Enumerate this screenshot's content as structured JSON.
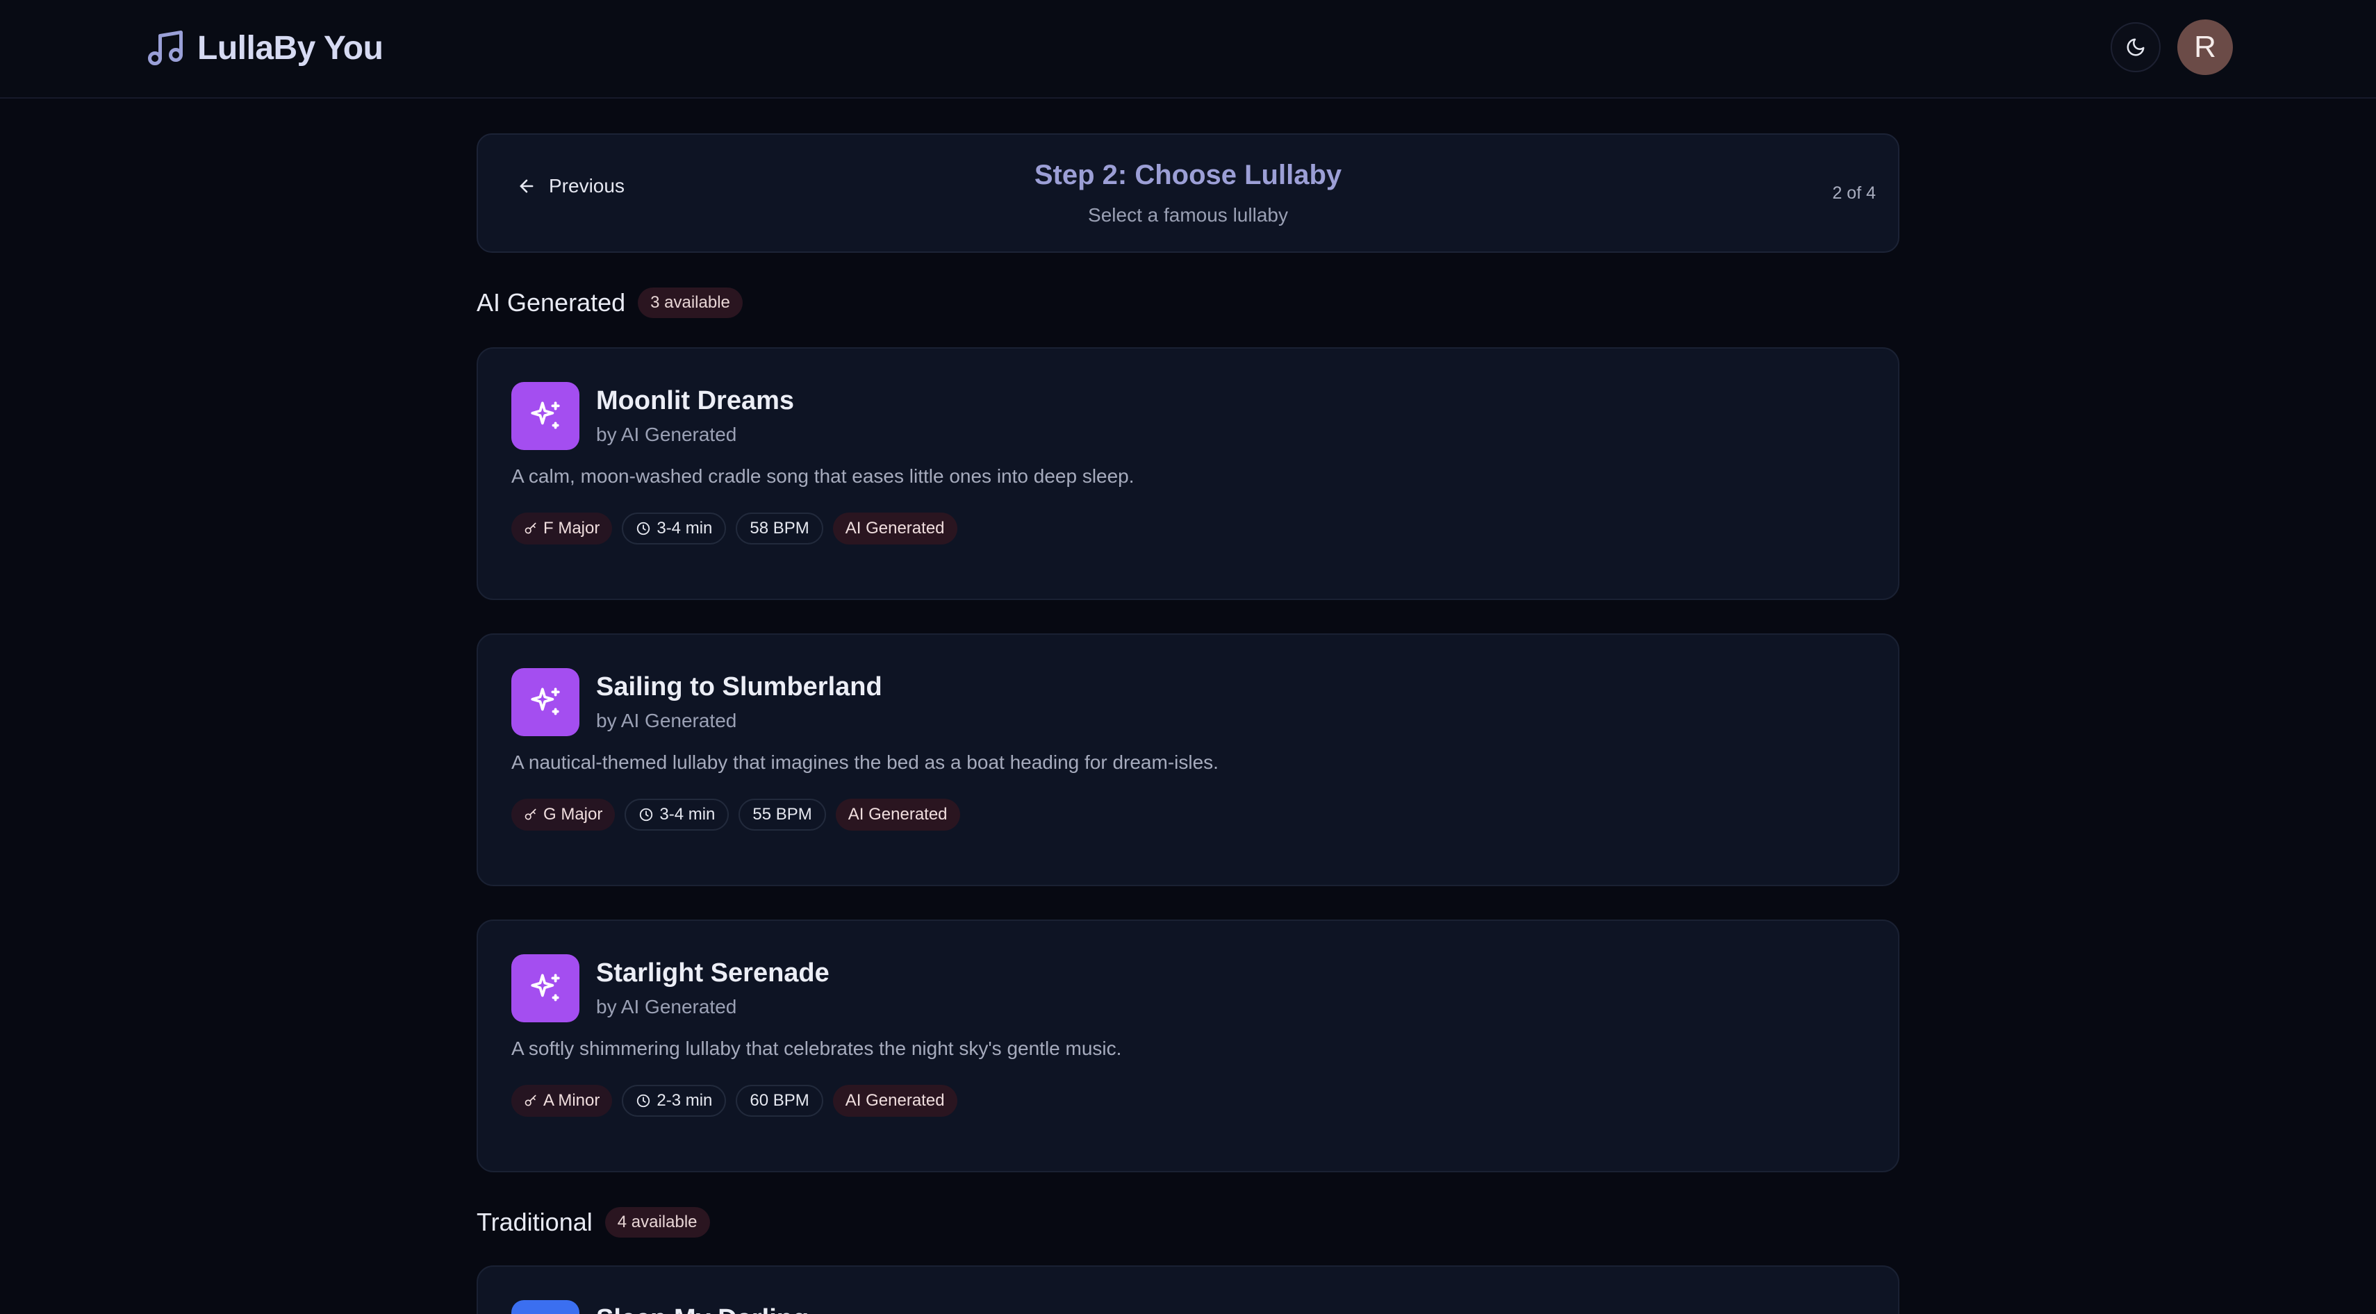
{
  "header": {
    "brand_name": "LullaBy You",
    "brand_icon": "music-note-icon",
    "theme_icon": "moon-icon",
    "avatar_initial": "R"
  },
  "step": {
    "previous_label": "Previous",
    "title": "Step 2: Choose Lullaby",
    "subtitle": "Select a famous lullaby",
    "count": "2 of 4"
  },
  "sections": [
    {
      "title": "AI Generated",
      "badge": "3 available",
      "cards": [
        {
          "title": "Moonlit Dreams",
          "author": "by AI Generated",
          "description": "A calm, moon-washed cradle song that eases little ones into deep sleep.",
          "key": "F Major",
          "duration": "3-4 min",
          "tempo": "58 BPM",
          "category": "AI Generated",
          "icon": "sparkles-icon"
        },
        {
          "title": "Sailing to Slumberland",
          "author": "by AI Generated",
          "description": "A nautical-themed lullaby that imagines the bed as a boat heading for dream-isles.",
          "key": "G Major",
          "duration": "3-4 min",
          "tempo": "55 BPM",
          "category": "AI Generated",
          "icon": "sparkles-icon"
        },
        {
          "title": "Starlight Serenade",
          "author": "by AI Generated",
          "description": "A softly shimmering lullaby that celebrates the night sky's gentle music.",
          "key": "A Minor",
          "duration": "2-3 min",
          "tempo": "60 BPM",
          "category": "AI Generated",
          "icon": "sparkles-icon"
        }
      ]
    },
    {
      "title": "Traditional",
      "badge": "4 available",
      "cards": [
        {
          "title": "Sleep My Darling"
        }
      ]
    }
  ],
  "colors": {
    "background": "#070912",
    "card": "#0e1424",
    "accent_purple": "#a44ef0",
    "accent_blue": "#3b6ff0",
    "title_lavender": "#9c9fd6"
  }
}
